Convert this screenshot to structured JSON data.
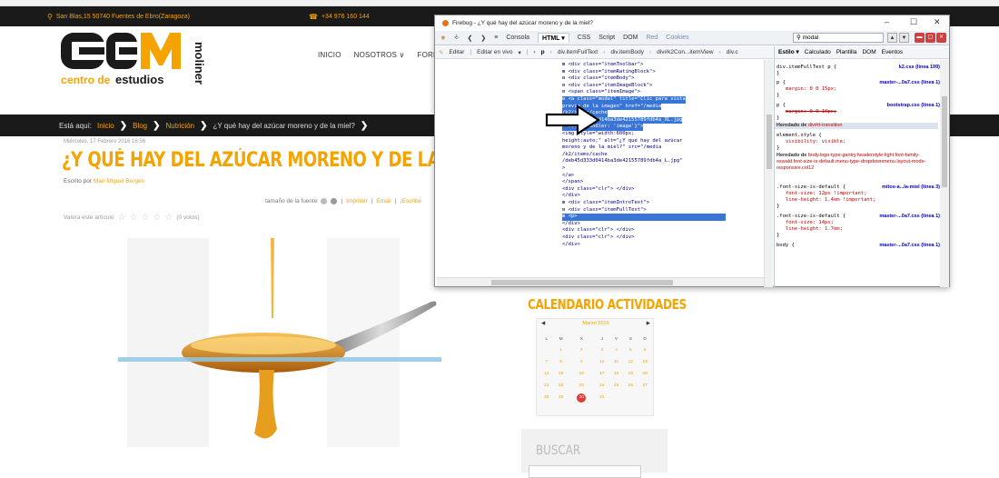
{
  "topbar": {
    "address": "San Blas,15 50740 Fuentes de Ebro(Zaragoza)",
    "phone": "+34 976 160 144"
  },
  "logo": {
    "letters": "CEM",
    "line1": "centro de",
    "line2": "estudios",
    "vertical": "molinɐr"
  },
  "nav": [
    "INICIO",
    "NOSOTROS ∨",
    "FORMACIÓN ∨"
  ],
  "breadcrumb": {
    "label": "Está aquí:",
    "items": [
      "Inicio",
      "Blog",
      "Nutrición",
      "¿Y qué hay del azúcar moreno y de la miel?"
    ]
  },
  "article": {
    "date": "Miércoles, 17 Febrero 2016 16:56",
    "title": "¿Y QUÉ HAY DEL AZÚCAR MORENO Y DE LA MIEL?",
    "author_prefix": "Escrito por",
    "author": "Mari Miguel Berges",
    "font_size_label": "tamaño de la fuente",
    "print": "Imprimir",
    "email": "Email",
    "write": "¡Escribe",
    "rating_label": "Valora este artículo",
    "votes": "(0 votos)"
  },
  "sidebar": {
    "calendar_title": "CALENDARIO ACTIVIDADES",
    "month": "Marzo 2016",
    "weekdays": [
      "L",
      "M",
      "X",
      "J",
      "V",
      "S",
      "D"
    ],
    "weeks": [
      [
        "",
        "1",
        "2",
        "3",
        "4",
        "5",
        "6"
      ],
      [
        "7",
        "8",
        "9",
        "10",
        "11",
        "12",
        "13"
      ],
      [
        "14",
        "15",
        "16",
        "17",
        "18",
        "19",
        "20"
      ],
      [
        "21",
        "22",
        "23",
        "24",
        "25",
        "26",
        "27"
      ],
      [
        "28",
        "29",
        "30",
        "31",
        "",
        "",
        ""
      ]
    ],
    "today": "30",
    "search_title": "BUSCAR"
  },
  "firebug": {
    "title": "Firebug - ¿Y qué hay del azúcar moreno y de la miel?",
    "tabs": [
      "Consola",
      "HTML ▾",
      "CSS",
      "Script",
      "DOM",
      "Red",
      "Cookies"
    ],
    "search_value": "modal",
    "toolbar": [
      "Editar",
      "Editar en vivo"
    ],
    "crumbs": [
      "p",
      "div.itemFullText",
      "div.itemBody",
      "div#k2Con...itemView",
      "div.c"
    ],
    "side_tabs": [
      "Estilo ▾",
      "Calculado",
      "Plantilla",
      "DOM",
      "Eventos"
    ],
    "html_lines": [
      "⊞ <div class=\"itemToolbar\">",
      "⊞ <div class=\"itemRatingBlock\">",
      "⊟ <div class=\"itemBody\">",
      "  ⊟ <div class=\"itemImageBlock\">",
      "    ⊟ <span class=\"itemImage\">",
      "      ⊟ <a class=\"modal\" title=\"Clic para vista",
      "         previa de la imagen\" href=\"/media",
      "         /k2/items/cache",
      "         /deb45d333d0414ba3de42155789fdb4a_XL.jpg",
      "         \" rel=\"{handler: 'image'}\">",
      "           <img style=\"width:600px;",
      "           height:auto;\" alt=\"¿Y qué hay del azúcar",
      "           moreno y de la miel?\" src=\"/media",
      "           /k2/items/cache",
      "           /deb45d333d0414ba3de42155789fdb4a_L.jpg\"",
      "           >",
      "         </a>",
      "      </span>",
      "      <div class=\"clr\"> </div>",
      "    </div>",
      "  ⊞ <div class=\"itemIntroText\">",
      "  ⊟ <div class=\"itemFullText\">",
      "    ⊞ <p>",
      "    </div>",
      "    <div class=\"clr\"> </div>",
      "    <div class=\"clr\"> </div>",
      "  </div>"
    ],
    "styles": {
      "r1_sel": "div.itemFullText p {",
      "r1_src": "k2.css (línea 199)",
      "r2_sel": "p {",
      "r2_src": "master-...0a7.css (línea 1)",
      "r2_prop": "margin: 0 0 15px;",
      "r3_sel": "p {",
      "r3_src": "bootstrap.css (línea 1)",
      "r3_prop": "margin: 0 0 10px;",
      "inh1_label": "Heredado de",
      "inh1_sel": "div#rt-transition",
      "r4_sel": "element.style {",
      "r4_prop": "visibility: visible;",
      "inh2_label": "Heredado de",
      "inh2_sel": "body.logo-type-gantry.headerstyle-light.font-family-oswald.font-size-is-default.menu-type-dropdownmenu.layout-mode-responsive.col12",
      "r5_sel": ".font-size-is-default {",
      "r5_src": "mitos-a...la-miel (línea 3)",
      "r5_p1": "font-size: 12px !important;",
      "r5_p2": "line-height: 1.4em !important;",
      "r6_sel": ".font-size-is-default {",
      "r6_src": "master-...0a7.css (línea 1)",
      "r6_p1": "font-size: 14px;",
      "r6_p2": "line-height: 1.7em;",
      "r7_sel": "body {",
      "r7_src": "master-...0a7.css (línea 1)"
    }
  },
  "colors": {
    "accent": "#f5a300",
    "dark": "#1a1a1a",
    "highlight": "#3875d7",
    "today": "#e53935"
  }
}
